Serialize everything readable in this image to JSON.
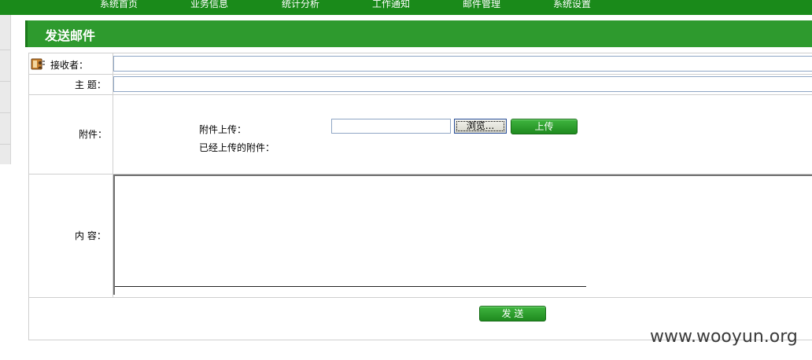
{
  "nav": {
    "items": [
      "系统首页",
      "业务信息",
      "统计分析",
      "工作通知",
      "邮件管理",
      "系统设置"
    ]
  },
  "banner": {
    "title": "发送邮件"
  },
  "form": {
    "recipient_label": "接收者：",
    "subject_label": "主  题：",
    "attachment_label": "附件：",
    "upload_label": "附件上传：",
    "uploaded_label": "已经上传的附件：",
    "browse_button": "浏览...",
    "upload_button": "上传",
    "content_label": "内  容：",
    "send_button": "发 送",
    "recipient_value": "",
    "subject_value": ""
  },
  "watermark": "www.wooyun.org",
  "colors": {
    "nav_green": "#1a8a1a",
    "banner_green": "#2e9a2e",
    "button_green": "#2a9a2a"
  },
  "icons": {
    "recipient": "address-book-icon"
  }
}
